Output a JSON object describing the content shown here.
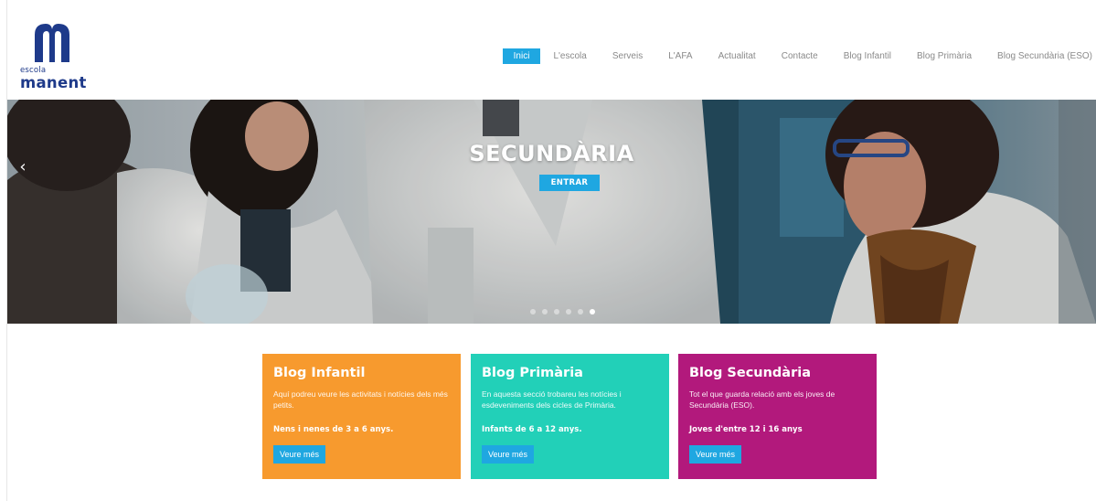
{
  "logo": {
    "small": "escola",
    "big": "manent"
  },
  "nav": {
    "items": [
      {
        "label": "Inici",
        "active": true
      },
      {
        "label": "L'escola"
      },
      {
        "label": "Serveis"
      },
      {
        "label": "L'AFA"
      },
      {
        "label": "Actualitat"
      },
      {
        "label": "Contacte"
      },
      {
        "label": "Blog Infantil"
      },
      {
        "label": "Blog Primària"
      },
      {
        "label": "Blog Secundària (ESO)"
      }
    ]
  },
  "hero": {
    "title": "SECUNDÀRIA",
    "button": "ENTRAR",
    "prev_arrow": "‹",
    "slide_count": 6,
    "active_slide": 6
  },
  "cards": [
    {
      "title": "Blog Infantil",
      "desc": "Aquí podreu veure les activitats i notícies dels més petits.",
      "age": "Nens i nenes de 3 a 6 anys.",
      "button": "Veure més",
      "color": "#f79a2e"
    },
    {
      "title": "Blog Primària",
      "desc": "En aquesta secció trobareu les notícies i esdeveniments dels cicles de Primària.",
      "age": "Infants de 6 a 12 anys.",
      "button": "Veure més",
      "color": "#22d0b8"
    },
    {
      "title": "Blog Secundària",
      "desc": "Tot el que guarda relació amb els joves de Secundària (ESO).",
      "age": "Joves d'entre 12 i 16 anys",
      "button": "Veure més",
      "color": "#b2197c"
    }
  ],
  "colors": {
    "accent": "#1fa7e1",
    "brand": "#1e3a8a"
  }
}
